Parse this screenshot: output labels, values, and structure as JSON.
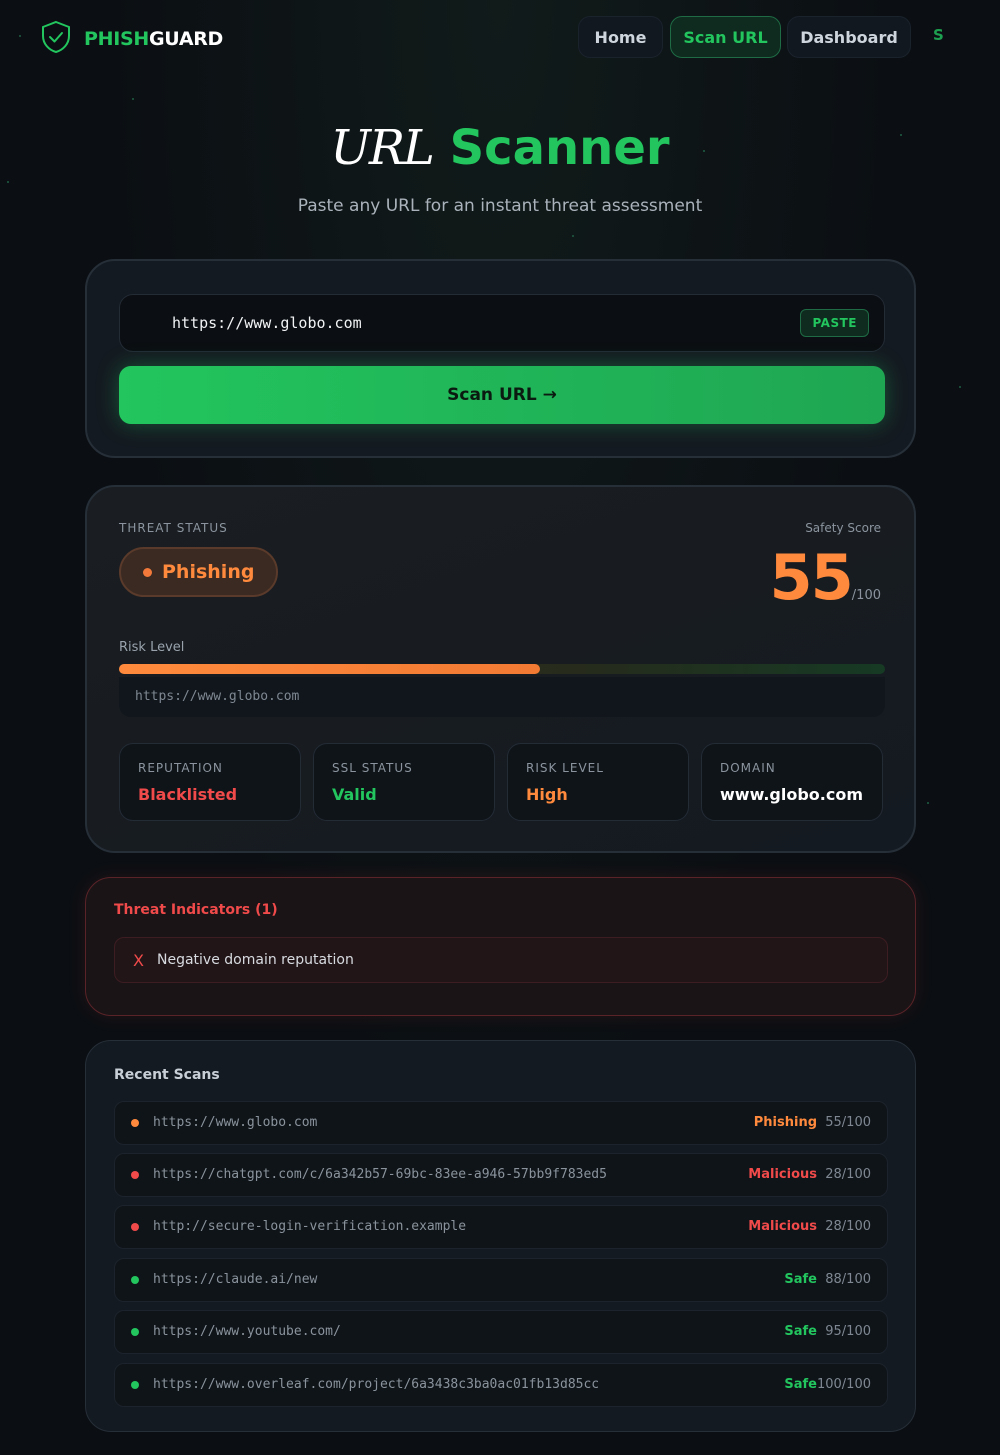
{
  "nav": {
    "brand_a": "PHISH",
    "brand_b": "GUARD",
    "items": [
      {
        "label": "Home",
        "active": false
      },
      {
        "label": "Scan URL",
        "active": true
      },
      {
        "label": "Dashboard",
        "active": false
      }
    ],
    "avatar": "S"
  },
  "hero": {
    "title_a": "URL",
    "title_b": "Scanner",
    "subtitle": "Paste any URL for an instant threat assessment"
  },
  "scan": {
    "url_value": "https://www.globo.com",
    "paste_label": "PASTE",
    "scan_label": "Scan URL →"
  },
  "result": {
    "status_label": "THREAT STATUS",
    "status": "Phishing",
    "score_label": "Safety Score",
    "score": "55",
    "score_max": "/100",
    "risk_label": "Risk Level",
    "risk_fraction": 0.55,
    "url": "https://www.globo.com",
    "stats": [
      {
        "label": "REPUTATION",
        "value": "Blacklisted",
        "color": "#f04a4a"
      },
      {
        "label": "SSL STATUS",
        "value": "Valid",
        "color": "#22c55e"
      },
      {
        "label": "RISK LEVEL",
        "value": "High",
        "color": "#ff8a3d"
      },
      {
        "label": "DOMAIN",
        "value": "www.globo.com",
        "color": "#ffffff"
      }
    ]
  },
  "threats": {
    "title": "Threat Indicators (1)",
    "items": [
      {
        "mark": "X",
        "text": "Negative domain reputation"
      }
    ]
  },
  "recent": {
    "title": "Recent Scans",
    "rows": [
      {
        "url": "https://www.globo.com",
        "status": "Phishing",
        "score": "55/100",
        "color": "#ff8a3d"
      },
      {
        "url": "https://chatgpt.com/c/6a342b57-69bc-83ee-a946-57bb9f783ed5",
        "status": "Malicious",
        "score": "28/100",
        "color": "#f04a4a"
      },
      {
        "url": "http://secure-login-verification.example",
        "status": "Malicious",
        "score": "28/100",
        "color": "#f04a4a"
      },
      {
        "url": "https://claude.ai/new",
        "status": "Safe",
        "score": "88/100",
        "color": "#22c55e"
      },
      {
        "url": "https://www.youtube.com/",
        "status": "Safe",
        "score": "95/100",
        "color": "#22c55e"
      },
      {
        "url": "https://www.overleaf.com/project/6a3438c3ba0ac01fb13d85cc",
        "status": "Safe",
        "score": "100/100",
        "color": "#22c55e"
      }
    ]
  },
  "colors": {
    "accent": "#22c55e",
    "warning": "#ff8a3d",
    "danger": "#f04a4a"
  }
}
